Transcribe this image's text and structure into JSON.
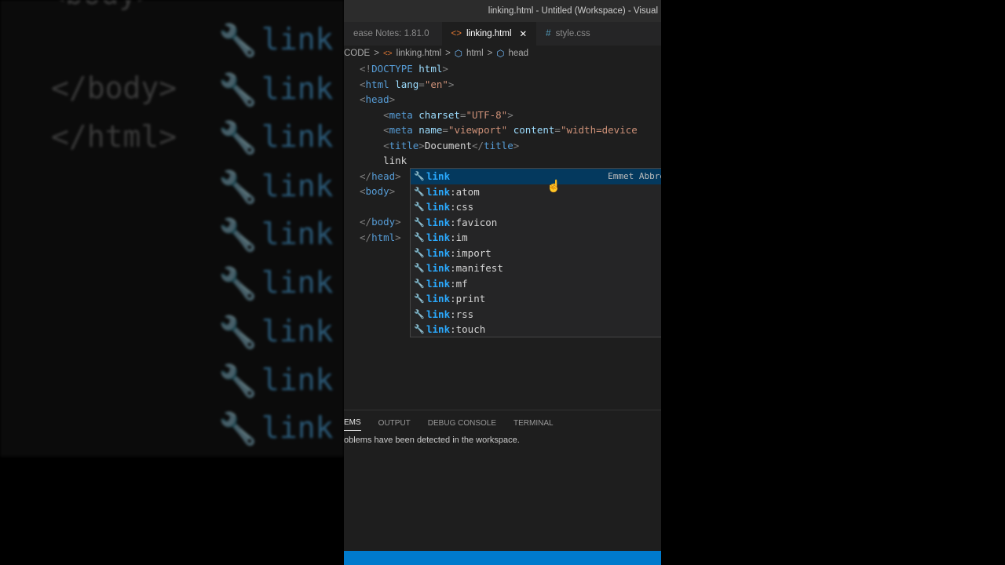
{
  "background": {
    "lines": [
      "</body>",
      "</html>"
    ],
    "link_word": "link",
    "wrench": "🔧"
  },
  "window": {
    "title": "linking.html - Untitled (Workspace) - Visual"
  },
  "tabs": [
    {
      "label": "ease Notes: 1.81.0"
    },
    {
      "label": "linking.html",
      "icon": "<>",
      "close": "✕"
    },
    {
      "label": "style.css",
      "icon": "#"
    }
  ],
  "breadcrumb": {
    "root": "CODE",
    "file": "linking.html",
    "html": "html",
    "head": "head",
    "sep": ">"
  },
  "code": {
    "l1": [
      "<!",
      "DOCTYPE",
      " html",
      ">"
    ],
    "l2": [
      "<",
      "html",
      " lang",
      "=",
      "\"en\"",
      ">"
    ],
    "l3": [
      "<",
      "head",
      ">"
    ],
    "l4": [
      "<",
      "meta",
      " charset",
      "=",
      "\"UTF-8\"",
      ">"
    ],
    "l5": [
      "<",
      "meta",
      " name",
      "=",
      "\"viewport\"",
      " content",
      "=",
      "\"width=device"
    ],
    "l6": [
      "<",
      "title",
      ">",
      "Document",
      "</",
      "title",
      ">"
    ],
    "l7": "link",
    "l8": [
      "</",
      "head",
      ">"
    ],
    "l9": [
      "<",
      "body",
      ">"
    ],
    "l11": [
      "</",
      "body",
      ">"
    ],
    "l12": [
      "</",
      "html",
      ">"
    ]
  },
  "suggest": {
    "match": "link",
    "detail": "Emmet Abbre",
    "items": [
      "",
      ":atom",
      ":css",
      ":favicon",
      ":im",
      ":import",
      ":manifest",
      ":mf",
      ":print",
      ":rss",
      ":touch"
    ]
  },
  "panel": {
    "tabs": [
      "EMS",
      "OUTPUT",
      "DEBUG CONSOLE",
      "TERMINAL"
    ],
    "message": "oblems have been detected in the workspace."
  },
  "colors": {
    "status": "#007acc",
    "selected": "#04395e"
  }
}
